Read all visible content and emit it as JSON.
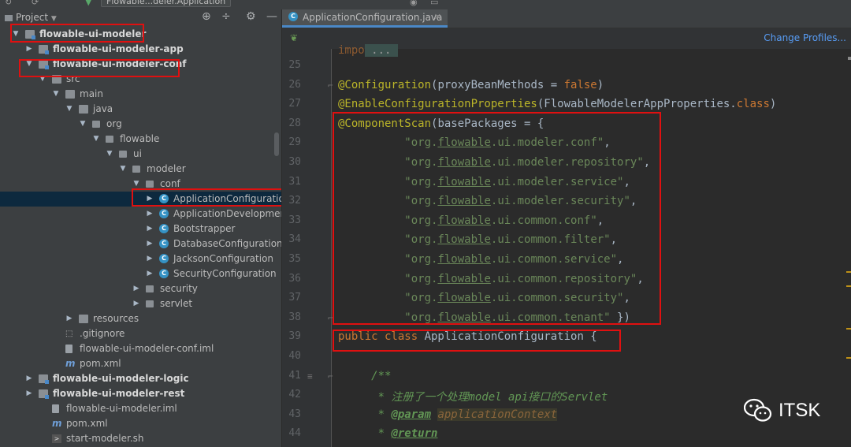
{
  "topbar": {
    "crumb": "Flowable...deler.Application"
  },
  "sidebar": {
    "title": "Project",
    "tree": [
      {
        "label": "flowable-ui-modeler",
        "depth": 0,
        "arrow": "▼",
        "icon": "module-folder",
        "bold": true
      },
      {
        "label": "flowable-ui-modeler-app",
        "depth": 1,
        "arrow": "▶",
        "icon": "module-folder",
        "bold": true
      },
      {
        "label": "flowable-ui-modeler-conf",
        "depth": 1,
        "arrow": "▼",
        "icon": "module-folder",
        "bold": true
      },
      {
        "label": "src",
        "depth": 2,
        "arrow": "▼",
        "icon": "folder"
      },
      {
        "label": "main",
        "depth": 3,
        "arrow": "▼",
        "icon": "folder"
      },
      {
        "label": "java",
        "depth": 4,
        "arrow": "▼",
        "icon": "folder"
      },
      {
        "label": "org",
        "depth": 5,
        "arrow": "▼",
        "icon": "package"
      },
      {
        "label": "flowable",
        "depth": 6,
        "arrow": "▼",
        "icon": "package"
      },
      {
        "label": "ui",
        "depth": 7,
        "arrow": "▼",
        "icon": "package"
      },
      {
        "label": "modeler",
        "depth": 8,
        "arrow": "▼",
        "icon": "package"
      },
      {
        "label": "conf",
        "depth": 9,
        "arrow": "▼",
        "icon": "package"
      },
      {
        "label": "ApplicationConfiguration",
        "depth": 10,
        "arrow": "▶",
        "icon": "class",
        "selected": true
      },
      {
        "label": "ApplicationDevelopment",
        "depth": 10,
        "arrow": "▶",
        "icon": "class"
      },
      {
        "label": "Bootstrapper",
        "depth": 10,
        "arrow": "▶",
        "icon": "class"
      },
      {
        "label": "DatabaseConfiguration",
        "depth": 10,
        "arrow": "▶",
        "icon": "class"
      },
      {
        "label": "JacksonConfiguration",
        "depth": 10,
        "arrow": "▶",
        "icon": "class"
      },
      {
        "label": "SecurityConfiguration",
        "depth": 10,
        "arrow": "▶",
        "icon": "class"
      },
      {
        "label": "security",
        "depth": 9,
        "arrow": "▶",
        "icon": "package"
      },
      {
        "label": "servlet",
        "depth": 9,
        "arrow": "▶",
        "icon": "package"
      },
      {
        "label": "resources",
        "depth": 4,
        "arrow": "▶",
        "icon": "folder"
      },
      {
        "label": ".gitignore",
        "depth": 3,
        "arrow": "",
        "icon": "gitignore"
      },
      {
        "label": "flowable-ui-modeler-conf.iml",
        "depth": 3,
        "arrow": "",
        "icon": "file"
      },
      {
        "label": "pom.xml",
        "depth": 3,
        "arrow": "",
        "icon": "maven"
      },
      {
        "label": "flowable-ui-modeler-logic",
        "depth": 1,
        "arrow": "▶",
        "icon": "module-folder",
        "bold": true
      },
      {
        "label": "flowable-ui-modeler-rest",
        "depth": 1,
        "arrow": "▶",
        "icon": "module-folder",
        "bold": true
      },
      {
        "label": "flowable-ui-modeler.iml",
        "depth": 2,
        "arrow": "",
        "icon": "file"
      },
      {
        "label": "pom.xml",
        "depth": 2,
        "arrow": "",
        "icon": "maven"
      },
      {
        "label": "start-modeler.sh",
        "depth": 2,
        "arrow": "",
        "icon": "shell"
      }
    ]
  },
  "editor": {
    "tab": "ApplicationConfiguration.java",
    "change_profiles": "Change Profiles...",
    "lines": [
      {
        "n": "25",
        "tokens": []
      },
      {
        "n": "26",
        "tokens": [
          [
            "ann",
            "@Configuration"
          ],
          [
            "p",
            "(proxyBeanMethods = "
          ],
          [
            "kw",
            "false"
          ],
          [
            "p",
            ")"
          ]
        ]
      },
      {
        "n": "27",
        "tokens": [
          [
            "ann",
            "@EnableConfigurationProperties"
          ],
          [
            "p",
            "(FlowableModelerAppProperties."
          ],
          [
            "kw",
            "class"
          ],
          [
            "p",
            ")"
          ]
        ]
      },
      {
        "n": "28",
        "tokens": [
          [
            "ann",
            "@ComponentScan"
          ],
          [
            "p",
            "(basePackages = {"
          ]
        ]
      },
      {
        "n": "29",
        "tokens": [
          [
            "p",
            "          "
          ],
          [
            "str",
            "\"org.flowable.ui.modeler.conf\""
          ],
          [
            "p",
            ","
          ]
        ]
      },
      {
        "n": "30",
        "tokens": [
          [
            "p",
            "          "
          ],
          [
            "str",
            "\"org.flowable.ui.modeler.repository\""
          ],
          [
            "p",
            ","
          ]
        ]
      },
      {
        "n": "31",
        "tokens": [
          [
            "p",
            "          "
          ],
          [
            "str",
            "\"org.flowable.ui.modeler.service\""
          ],
          [
            "p",
            ","
          ]
        ]
      },
      {
        "n": "32",
        "tokens": [
          [
            "p",
            "          "
          ],
          [
            "str",
            "\"org.flowable.ui.modeler.security\""
          ],
          [
            "p",
            ","
          ]
        ]
      },
      {
        "n": "33",
        "tokens": [
          [
            "p",
            "          "
          ],
          [
            "str",
            "\"org.flowable.ui.common.conf\""
          ],
          [
            "p",
            ","
          ]
        ]
      },
      {
        "n": "34",
        "tokens": [
          [
            "p",
            "          "
          ],
          [
            "str",
            "\"org.flowable.ui.common.filter\""
          ],
          [
            "p",
            ","
          ]
        ]
      },
      {
        "n": "35",
        "tokens": [
          [
            "p",
            "          "
          ],
          [
            "str",
            "\"org.flowable.ui.common.service\""
          ],
          [
            "p",
            ","
          ]
        ]
      },
      {
        "n": "36",
        "tokens": [
          [
            "p",
            "          "
          ],
          [
            "str",
            "\"org.flowable.ui.common.repository\""
          ],
          [
            "p",
            ","
          ]
        ]
      },
      {
        "n": "37",
        "tokens": [
          [
            "p",
            "          "
          ],
          [
            "str",
            "\"org.flowable.ui.common.security\""
          ],
          [
            "p",
            ","
          ]
        ]
      },
      {
        "n": "38",
        "tokens": [
          [
            "p",
            "          "
          ],
          [
            "str",
            "\"org.flowable.ui.common.tenant\""
          ],
          [
            "p",
            " })"
          ]
        ]
      },
      {
        "n": "39",
        "tokens": [
          [
            "kw",
            "public class "
          ],
          [
            "p",
            "ApplicationConfiguration {"
          ]
        ]
      },
      {
        "n": "40",
        "tokens": []
      },
      {
        "n": "41",
        "tokens": [
          [
            "p",
            "     "
          ],
          [
            "cmt",
            "/**"
          ]
        ]
      },
      {
        "n": "42",
        "tokens": [
          [
            "p",
            "      "
          ],
          [
            "cmt",
            "* 注册了一个处理model api接口的Servlet"
          ]
        ]
      },
      {
        "n": "43",
        "tokens": [
          [
            "p",
            "      "
          ],
          [
            "cmt",
            "* "
          ],
          [
            "doctag",
            "@param"
          ],
          [
            "cmt",
            " "
          ],
          [
            "docparam",
            "applicationContext"
          ]
        ]
      },
      {
        "n": "44",
        "tokens": [
          [
            "p",
            "      "
          ],
          [
            "cmt",
            "* "
          ],
          [
            "doctag",
            "@return"
          ]
        ]
      }
    ]
  },
  "watermark": {
    "text": "ITSK"
  },
  "colors": {
    "highlight_box": "#e01010",
    "annotation": "#bbb529",
    "keyword": "#cc7832",
    "string": "#6a8759",
    "comment": "#629755",
    "selection": "#0d293e"
  }
}
